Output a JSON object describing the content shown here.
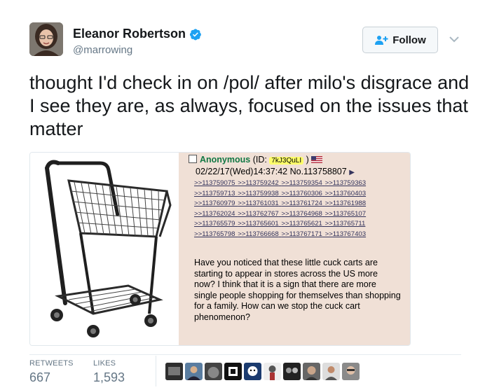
{
  "user": {
    "name": "Eleanor Robertson",
    "handle": "@marrowing",
    "verified": true
  },
  "follow_button": {
    "label": "Follow",
    "icon": "follow-person-icon"
  },
  "tweet": {
    "text": "thought I'd check in on /pol/ after milo's disgrace and I see they are, as always, focused on the issues that matter"
  },
  "media": {
    "post": {
      "name": "Anonymous",
      "id_prefix": "(ID: ",
      "id": "7kJ3QuLI",
      "id_suffix": " )",
      "datetime": "02/22/17(Wed)14:37:42",
      "post_no": "No.113758807",
      "backlinks": [
        ">>113759075",
        ">>113759242",
        ">>113759354",
        ">>113759363",
        ">>113759713",
        ">>113759938",
        ">>113760306",
        ">>113760403",
        ">>113760979",
        ">>113761031",
        ">>113761724",
        ">>113761988",
        ">>113762024",
        ">>113762767",
        ">>113764968",
        ">>113765107",
        ">>113765579",
        ">>113765601",
        ">>113765621",
        ">>113765711",
        ">>113765798",
        ">>113766668",
        ">>113767171",
        ">>113767403"
      ],
      "body": "Have you noticed that these little cuck carts are starting to appear in stores across the US more now? I think that it is a sign that there are more single people shopping for themselves than shopping for a family. How can we stop the cuck cart phenomenon?"
    }
  },
  "stats": {
    "retweets_label": "RETWEETS",
    "retweets": "667",
    "likes_label": "LIKES",
    "likes": "1,593"
  },
  "colors": {
    "verified_blue": "#1da1f2",
    "anon_green": "#117743",
    "link_blue": "#34345c",
    "post_bg": "#f0e0d6"
  }
}
